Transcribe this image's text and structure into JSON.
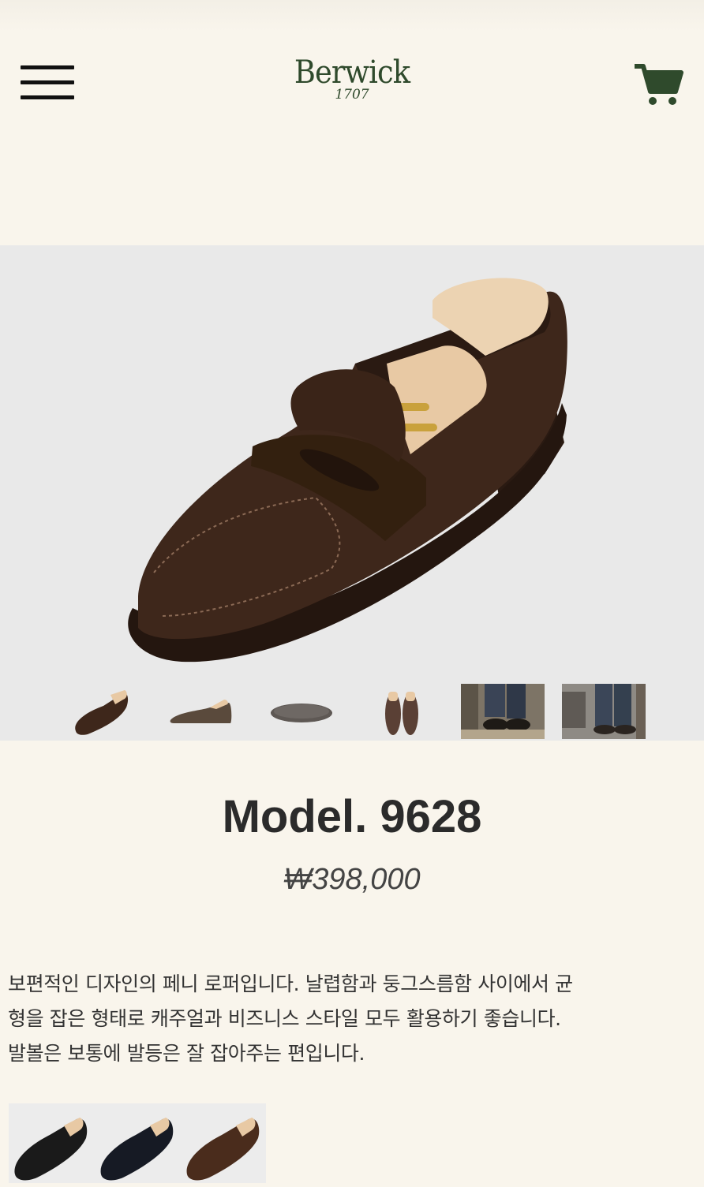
{
  "header": {
    "menu_icon": "hamburger-menu-icon",
    "logo": {
      "name": "Berwick",
      "year": "1707"
    },
    "cart_icon": "shopping-cart-icon",
    "brand_color": "#2f4a2c"
  },
  "gallery": {
    "main_image": "brown suede penny loafer with wooden shoe tree",
    "thumbnails": [
      {
        "icon": "loafer-angle-thumbnail"
      },
      {
        "icon": "loafer-side-thumbnail"
      },
      {
        "icon": "loafer-sole-thumbnail"
      },
      {
        "icon": "loafer-pair-top-thumbnail"
      },
      {
        "icon": "lifestyle-photo-thumbnail"
      },
      {
        "icon": "lifestyle-photo-thumbnail"
      }
    ]
  },
  "product": {
    "title": "Model. 9628",
    "price": "₩398,000",
    "description": " 보편적인 디자인의 페니 로퍼입니다. 날렵함과 둥그스름함 사이에서 균\n형을 잡은 형태로 캐주얼과 비즈니스 스타일 모두 활용하기 좋습니다.\n발볼은 보통에 발등은 잘 잡아주는 편입니다."
  },
  "variants": [
    {
      "icon": "black-leather-loafer-swatch",
      "color": "#1a1a1a"
    },
    {
      "icon": "navy-suede-loafer-swatch",
      "color": "#161a24"
    },
    {
      "icon": "brown-leather-loafer-swatch",
      "color": "#4a2c1c"
    }
  ]
}
